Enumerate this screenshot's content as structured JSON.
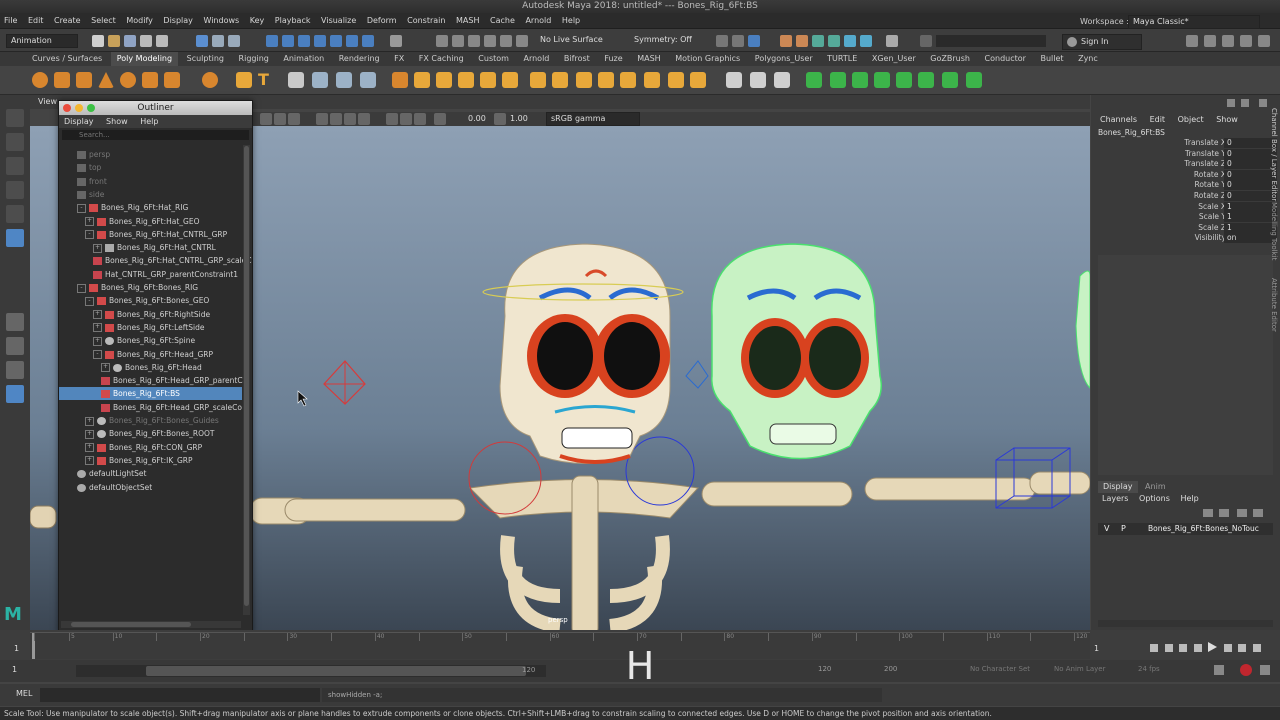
{
  "window": {
    "title": "Autodesk Maya 2018: untitled*   ---   Bones_Rig_6Ft:BS"
  },
  "menubar": [
    "File",
    "Edit",
    "Create",
    "Select",
    "Modify",
    "Display",
    "Windows",
    "Key",
    "Playback",
    "Visualize",
    "Deform",
    "Constrain",
    "MASH",
    "Cache",
    "Arnold",
    "Help"
  ],
  "status": {
    "mode": "Animation",
    "live_surface": "No Live Surface",
    "symmetry": "Symmetry: Off",
    "sign_in": "Sign In",
    "workspace_label": "Workspace :",
    "workspace": "Maya Classic*"
  },
  "shelf_tabs": [
    "Curves / Surfaces",
    "Poly Modeling",
    "Sculpting",
    "Rigging",
    "Animation",
    "Rendering",
    "FX",
    "FX Caching",
    "Custom",
    "Arnold",
    "Bifrost",
    "Fuze",
    "MASH",
    "Motion Graphics",
    "Polygons_User",
    "TURTLE",
    "XGen_User",
    "GoZBrush",
    "Conductor",
    "Bullet",
    "Zync"
  ],
  "shelf_active": "Poly Modeling",
  "viewport": {
    "panel_menu": "View",
    "exposure": "0.00",
    "gamma": "1.00",
    "color_space": "sRGB gamma",
    "camera_label": "persp"
  },
  "outliner": {
    "title": "Outliner",
    "menu": [
      "Display",
      "Show",
      "Help"
    ],
    "search_placeholder": "Search...",
    "rows": [
      {
        "label": "persp",
        "depth": 0,
        "dim": true,
        "icon": "camera"
      },
      {
        "label": "top",
        "depth": 0,
        "dim": true,
        "icon": "camera"
      },
      {
        "label": "front",
        "depth": 0,
        "dim": true,
        "icon": "camera"
      },
      {
        "label": "side",
        "depth": 0,
        "dim": true,
        "icon": "camera"
      },
      {
        "label": "Bones_Rig_6Ft:Hat_RIG",
        "depth": 0,
        "icon": "group",
        "exp": "-"
      },
      {
        "label": "Bones_Rig_6Ft:Hat_GEO",
        "depth": 1,
        "icon": "group",
        "exp": "+"
      },
      {
        "label": "Bones_Rig_6Ft:Hat_CNTRL_GRP",
        "depth": 1,
        "icon": "group",
        "exp": "-"
      },
      {
        "label": "Bones_Rig_6Ft:Hat_CNTRL",
        "depth": 2,
        "icon": "curve",
        "exp": "+"
      },
      {
        "label": "Bones_Rig_6Ft:Hat_CNTRL_GRP_scaleC",
        "depth": 2,
        "icon": "constraint"
      },
      {
        "label": "Hat_CNTRL_GRP_parentConstraint1",
        "depth": 2,
        "icon": "constraint"
      },
      {
        "label": "Bones_Rig_6Ft:Bones_RIG",
        "depth": 0,
        "icon": "group",
        "exp": "-"
      },
      {
        "label": "Bones_Rig_6Ft:Bones_GEO",
        "depth": 1,
        "icon": "group",
        "exp": "-"
      },
      {
        "label": "Bones_Rig_6Ft:RightSide",
        "depth": 2,
        "icon": "group",
        "exp": "+"
      },
      {
        "label": "Bones_Rig_6Ft:LeftSide",
        "depth": 2,
        "icon": "group",
        "exp": "+"
      },
      {
        "label": "Bones_Rig_6Ft:Spine",
        "depth": 2,
        "icon": "joint",
        "exp": "+"
      },
      {
        "label": "Bones_Rig_6Ft:Head_GRP",
        "depth": 2,
        "icon": "group",
        "exp": "-"
      },
      {
        "label": "Bones_Rig_6Ft:Head",
        "depth": 3,
        "icon": "joint",
        "exp": "+"
      },
      {
        "label": "Bones_Rig_6Ft:Head_GRP_parentC",
        "depth": 3,
        "icon": "constraint"
      },
      {
        "label": "Bones_Rig_6Ft:BS",
        "depth": 3,
        "icon": "group",
        "selected": true
      },
      {
        "label": "Bones_Rig_6Ft:Head_GRP_scaleCo",
        "depth": 3,
        "icon": "constraint"
      },
      {
        "label": "Bones_Rig_6Ft:Bones_Guides",
        "depth": 1,
        "dim": true,
        "icon": "joint",
        "exp": "+"
      },
      {
        "label": "Bones_Rig_6Ft:Bones_ROOT",
        "depth": 1,
        "icon": "joint",
        "exp": "+"
      },
      {
        "label": "Bones_Rig_6Ft:CON_GRP",
        "depth": 1,
        "icon": "group",
        "exp": "+"
      },
      {
        "label": "Bones_Rig_6Ft:IK_GRP",
        "depth": 1,
        "icon": "group",
        "exp": "+"
      },
      {
        "label": "defaultLightSet",
        "depth": 0,
        "icon": "set"
      },
      {
        "label": "defaultObjectSet",
        "depth": 0,
        "icon": "set"
      }
    ]
  },
  "channelbox": {
    "menu": [
      "Channels",
      "Edit",
      "Object",
      "Show"
    ],
    "object": "Bones_Rig_6Ft:BS",
    "attributes": [
      {
        "name": "Translate X",
        "value": "0"
      },
      {
        "name": "Translate Y",
        "value": "0"
      },
      {
        "name": "Translate Z",
        "value": "0"
      },
      {
        "name": "Rotate X",
        "value": "0"
      },
      {
        "name": "Rotate Y",
        "value": "0"
      },
      {
        "name": "Rotate Z",
        "value": "0"
      },
      {
        "name": "Scale X",
        "value": "1"
      },
      {
        "name": "Scale Y",
        "value": "1"
      },
      {
        "name": "Scale Z",
        "value": "1"
      },
      {
        "name": "Visibility",
        "value": "on"
      }
    ],
    "layer_tabs": [
      "Display",
      "Anim"
    ],
    "layer_menu": [
      "Layers",
      "Options",
      "Help"
    ],
    "layer": {
      "v": "V",
      "p": "P",
      "name": "Bones_Rig_6Ft:Bones_NoTouc"
    }
  },
  "side_tabs": [
    "Channel Box / Layer Editor",
    "Modelling Toolkit",
    "Attribute Editor"
  ],
  "timeline": {
    "current_frame": "1",
    "start": "1",
    "range_start": "1",
    "range_end": "120",
    "end": "120",
    "max": "200",
    "char_set": "No Character Set",
    "anim_layer": "No Anim Layer",
    "fps": "24 fps",
    "ticks": [
      1,
      5,
      10,
      15,
      20,
      25,
      30,
      35,
      40,
      45,
      50,
      55,
      60,
      65,
      70,
      75,
      80,
      85,
      90,
      95,
      100,
      105,
      110,
      115,
      120
    ]
  },
  "command": {
    "lang": "MEL",
    "text": "showHidden -a;"
  },
  "overlay_letter": "H",
  "help_text": "Scale Tool: Use manipulator to scale object(s). Shift+drag manipulator axis or plane handles to extrude components or clone objects. Ctrl+Shift+LMB+drag to constrain scaling to connected edges. Use D or HOME to change the pivot position and axis orientation.",
  "colors": {
    "selection": "#5286bc",
    "viewport_top": "#8ea0b4",
    "viewport_bottom": "#3b4653",
    "bone": "#e8dcc0",
    "wire": "#5cff86",
    "maya_logo": "#2bb3a5"
  }
}
